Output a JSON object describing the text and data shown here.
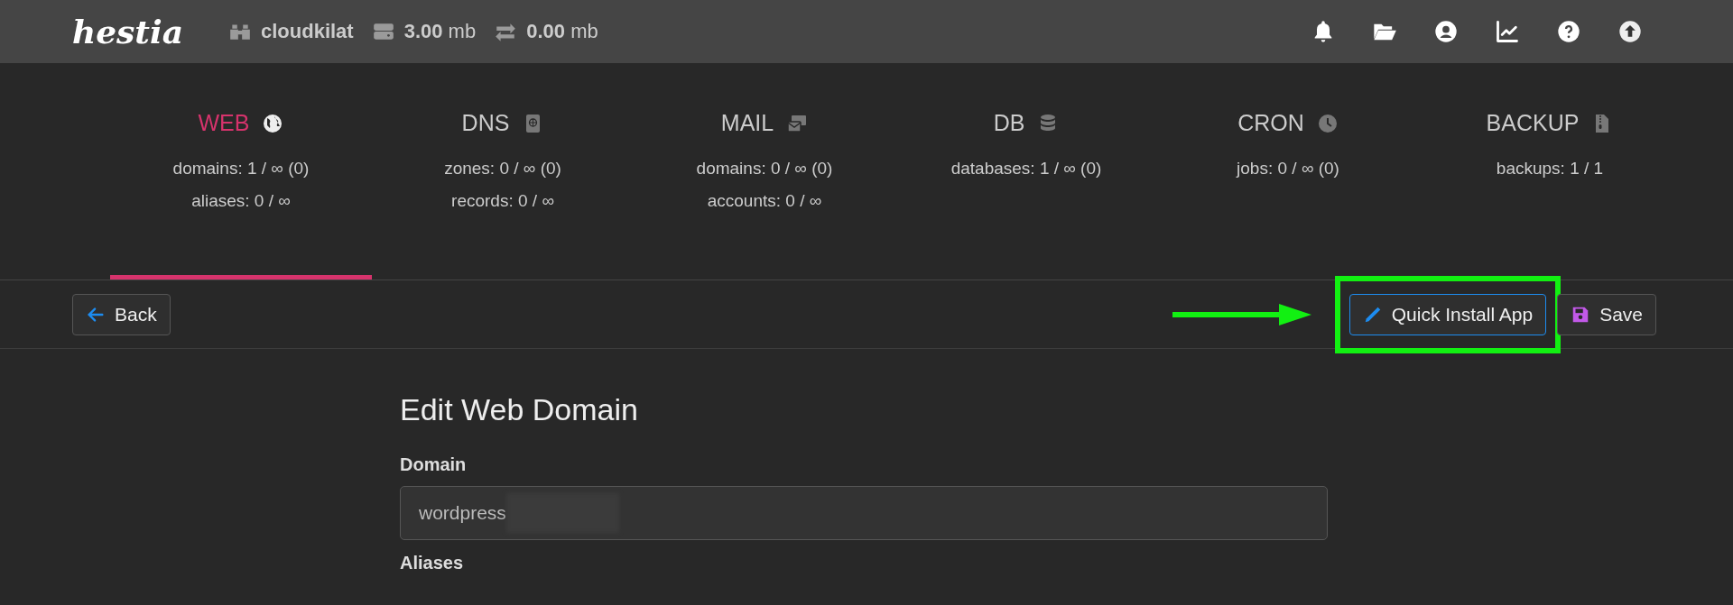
{
  "header": {
    "logo": "hestia",
    "user": "cloudkilat",
    "disk": {
      "value": "3.00",
      "unit": "mb"
    },
    "bandwidth": {
      "value": "0.00",
      "unit": "mb"
    }
  },
  "tabs": [
    {
      "label": "WEB",
      "selected": true,
      "stats": [
        "domains: 1 / ∞ (0)",
        "aliases: 0 / ∞"
      ]
    },
    {
      "label": "DNS",
      "selected": false,
      "stats": [
        "zones: 0 / ∞ (0)",
        "records: 0 / ∞"
      ]
    },
    {
      "label": "MAIL",
      "selected": false,
      "stats": [
        "domains: 0 / ∞ (0)",
        "accounts: 0 / ∞"
      ]
    },
    {
      "label": "DB",
      "selected": false,
      "stats": [
        "databases: 1 / ∞ (0)"
      ]
    },
    {
      "label": "CRON",
      "selected": false,
      "stats": [
        "jobs: 0 / ∞ (0)"
      ]
    },
    {
      "label": "BACKUP",
      "selected": false,
      "stats": [
        "backups: 1 / 1"
      ]
    }
  ],
  "toolbar": {
    "back": "Back",
    "buttons": [
      {
        "label": "Quick Install App",
        "focused": true,
        "highlighted": true
      },
      {
        "label": "Save",
        "focused": false,
        "highlighted": false
      }
    ]
  },
  "form": {
    "title": "Edit Web Domain",
    "fields": [
      {
        "label": "Domain",
        "value": "wordpress",
        "redacted": true
      },
      {
        "label": "Aliases"
      }
    ]
  }
}
